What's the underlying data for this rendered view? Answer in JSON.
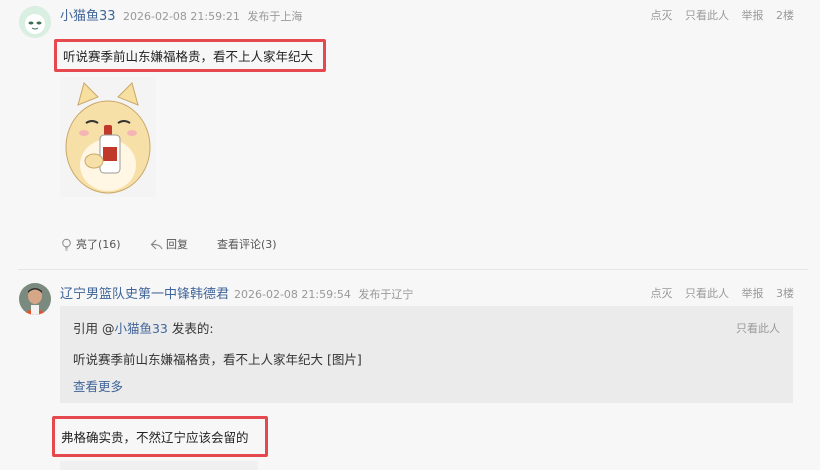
{
  "posts": [
    {
      "username": "小猫鱼33",
      "timestamp": "2026-02-08 21:59:21",
      "location": "发布于上海",
      "actions": {
        "dislike": "点灭",
        "only_this": "只看此人",
        "report": "举报",
        "floor": "2楼"
      },
      "content": "听说赛季前山东嫌福格贵，看不上人家年纪大",
      "footer": {
        "like": "亮了(16)",
        "reply": "回复",
        "view_comments": "查看评论(3)"
      }
    },
    {
      "username": "辽宁男篮队史第一中锋韩德君",
      "timestamp": "2026-02-08 21:59:54",
      "location": "发布于辽宁",
      "actions": {
        "dislike": "点灭",
        "only_this": "只看此人",
        "report": "举报",
        "floor": "3楼"
      },
      "quote": {
        "prefix": "引用 @",
        "user": "小猫鱼33",
        "suffix": " 发表的:",
        "only_this": "只看此人",
        "text": "听说赛季前山东嫌福格贵，看不上人家年纪大 [图片]",
        "more": "查看更多"
      },
      "content": "弗格确实贵，不然辽宁应该会留的"
    }
  ]
}
